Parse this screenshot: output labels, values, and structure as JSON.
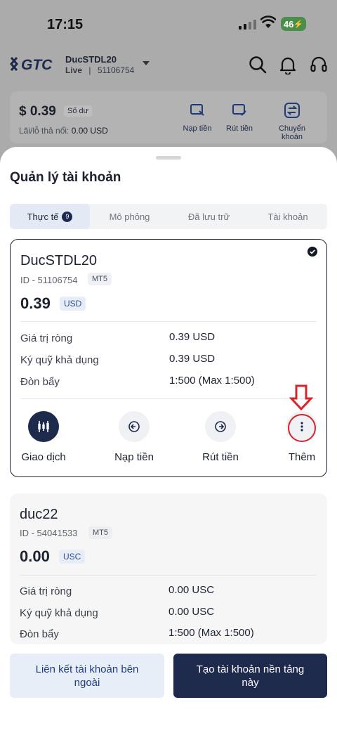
{
  "status_bar": {
    "time": "17:15",
    "battery": "46"
  },
  "header": {
    "logo_text": "GTC",
    "account_name": "DucSTDL20",
    "account_type": "Live",
    "account_id": "51106754"
  },
  "balance_card": {
    "amount": "$ 0.39",
    "amount_label": "Số dư",
    "pl_label": "Lãi/lỗ thả nổi:",
    "pl_value": "0.00 USD",
    "actions": [
      "Nạp tiền",
      "Rút tiền",
      "Chuyển khoản"
    ]
  },
  "sheet": {
    "title": "Quản lý tài khoản",
    "tabs": [
      {
        "label": "Thực tế",
        "count": "9"
      },
      {
        "label": "Mô phỏng"
      },
      {
        "label": "Đã lưu trữ"
      },
      {
        "label": "Tài khoản"
      }
    ]
  },
  "accounts": [
    {
      "name": "DucSTDL20",
      "id": "ID - 51106754",
      "platform": "MT5",
      "balance": "0.39",
      "currency": "USD",
      "rows": [
        {
          "label": "Giá trị ròng",
          "value": "0.39 USD"
        },
        {
          "label": "Ký quỹ khả dụng",
          "value": "0.39 USD"
        },
        {
          "label": "Đòn bẩy",
          "value": "1:500 (Max 1:500)"
        }
      ],
      "actions": [
        "Giao dịch",
        "Nạp tiền",
        "Rút tiền",
        "Thêm"
      ]
    },
    {
      "name": "duc22",
      "id": "ID - 54041533",
      "platform": "MT5",
      "balance": "0.00",
      "currency": "USC",
      "rows": [
        {
          "label": "Giá trị ròng",
          "value": "0.00 USC"
        },
        {
          "label": "Ký quỹ khả dụng",
          "value": "0.00 USC"
        },
        {
          "label": "Đòn bẩy",
          "value": "1:500 (Max 1:500)"
        }
      ]
    }
  ],
  "footer": {
    "link_button": "Liên kết tài khoản bên ngoài",
    "create_button": "Tạo tài khoản nền tảng này"
  },
  "colors": {
    "primary": "#1e2a4c",
    "annotation_red": "#d9242a"
  }
}
